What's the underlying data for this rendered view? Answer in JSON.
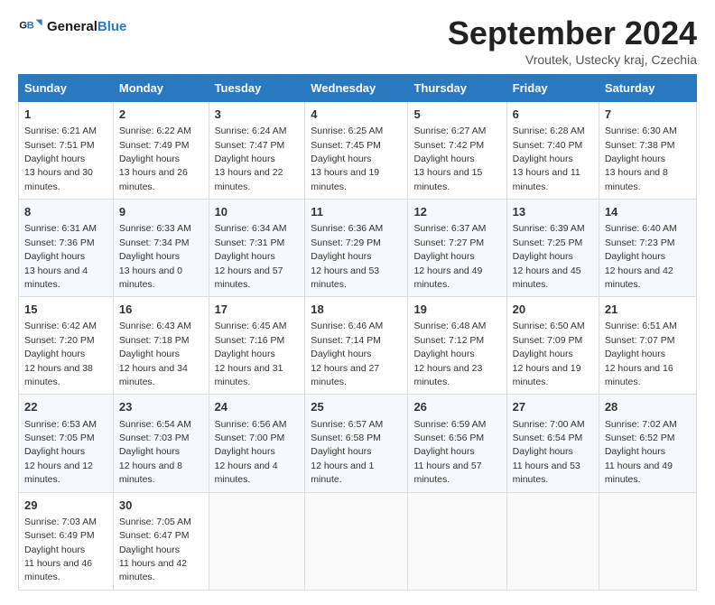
{
  "header": {
    "logo_line1": "General",
    "logo_line2": "Blue",
    "month_title": "September 2024",
    "subtitle": "Vroutek, Ustecky kraj, Czechia"
  },
  "weekdays": [
    "Sunday",
    "Monday",
    "Tuesday",
    "Wednesday",
    "Thursday",
    "Friday",
    "Saturday"
  ],
  "weeks": [
    [
      {
        "day": 1,
        "rise": "6:21 AM",
        "set": "7:51 PM",
        "hours": "13 hours and 30 minutes."
      },
      {
        "day": 2,
        "rise": "6:22 AM",
        "set": "7:49 PM",
        "hours": "13 hours and 26 minutes."
      },
      {
        "day": 3,
        "rise": "6:24 AM",
        "set": "7:47 PM",
        "hours": "13 hours and 22 minutes."
      },
      {
        "day": 4,
        "rise": "6:25 AM",
        "set": "7:45 PM",
        "hours": "13 hours and 19 minutes."
      },
      {
        "day": 5,
        "rise": "6:27 AM",
        "set": "7:42 PM",
        "hours": "13 hours and 15 minutes."
      },
      {
        "day": 6,
        "rise": "6:28 AM",
        "set": "7:40 PM",
        "hours": "13 hours and 11 minutes."
      },
      {
        "day": 7,
        "rise": "6:30 AM",
        "set": "7:38 PM",
        "hours": "13 hours and 8 minutes."
      }
    ],
    [
      {
        "day": 8,
        "rise": "6:31 AM",
        "set": "7:36 PM",
        "hours": "13 hours and 4 minutes."
      },
      {
        "day": 9,
        "rise": "6:33 AM",
        "set": "7:34 PM",
        "hours": "13 hours and 0 minutes."
      },
      {
        "day": 10,
        "rise": "6:34 AM",
        "set": "7:31 PM",
        "hours": "12 hours and 57 minutes."
      },
      {
        "day": 11,
        "rise": "6:36 AM",
        "set": "7:29 PM",
        "hours": "12 hours and 53 minutes."
      },
      {
        "day": 12,
        "rise": "6:37 AM",
        "set": "7:27 PM",
        "hours": "12 hours and 49 minutes."
      },
      {
        "day": 13,
        "rise": "6:39 AM",
        "set": "7:25 PM",
        "hours": "12 hours and 45 minutes."
      },
      {
        "day": 14,
        "rise": "6:40 AM",
        "set": "7:23 PM",
        "hours": "12 hours and 42 minutes."
      }
    ],
    [
      {
        "day": 15,
        "rise": "6:42 AM",
        "set": "7:20 PM",
        "hours": "12 hours and 38 minutes."
      },
      {
        "day": 16,
        "rise": "6:43 AM",
        "set": "7:18 PM",
        "hours": "12 hours and 34 minutes."
      },
      {
        "day": 17,
        "rise": "6:45 AM",
        "set": "7:16 PM",
        "hours": "12 hours and 31 minutes."
      },
      {
        "day": 18,
        "rise": "6:46 AM",
        "set": "7:14 PM",
        "hours": "12 hours and 27 minutes."
      },
      {
        "day": 19,
        "rise": "6:48 AM",
        "set": "7:12 PM",
        "hours": "12 hours and 23 minutes."
      },
      {
        "day": 20,
        "rise": "6:50 AM",
        "set": "7:09 PM",
        "hours": "12 hours and 19 minutes."
      },
      {
        "day": 21,
        "rise": "6:51 AM",
        "set": "7:07 PM",
        "hours": "12 hours and 16 minutes."
      }
    ],
    [
      {
        "day": 22,
        "rise": "6:53 AM",
        "set": "7:05 PM",
        "hours": "12 hours and 12 minutes."
      },
      {
        "day": 23,
        "rise": "6:54 AM",
        "set": "7:03 PM",
        "hours": "12 hours and 8 minutes."
      },
      {
        "day": 24,
        "rise": "6:56 AM",
        "set": "7:00 PM",
        "hours": "12 hours and 4 minutes."
      },
      {
        "day": 25,
        "rise": "6:57 AM",
        "set": "6:58 PM",
        "hours": "12 hours and 1 minute."
      },
      {
        "day": 26,
        "rise": "6:59 AM",
        "set": "6:56 PM",
        "hours": "11 hours and 57 minutes."
      },
      {
        "day": 27,
        "rise": "7:00 AM",
        "set": "6:54 PM",
        "hours": "11 hours and 53 minutes."
      },
      {
        "day": 28,
        "rise": "7:02 AM",
        "set": "6:52 PM",
        "hours": "11 hours and 49 minutes."
      }
    ],
    [
      {
        "day": 29,
        "rise": "7:03 AM",
        "set": "6:49 PM",
        "hours": "11 hours and 46 minutes."
      },
      {
        "day": 30,
        "rise": "7:05 AM",
        "set": "6:47 PM",
        "hours": "11 hours and 42 minutes."
      },
      null,
      null,
      null,
      null,
      null
    ]
  ]
}
